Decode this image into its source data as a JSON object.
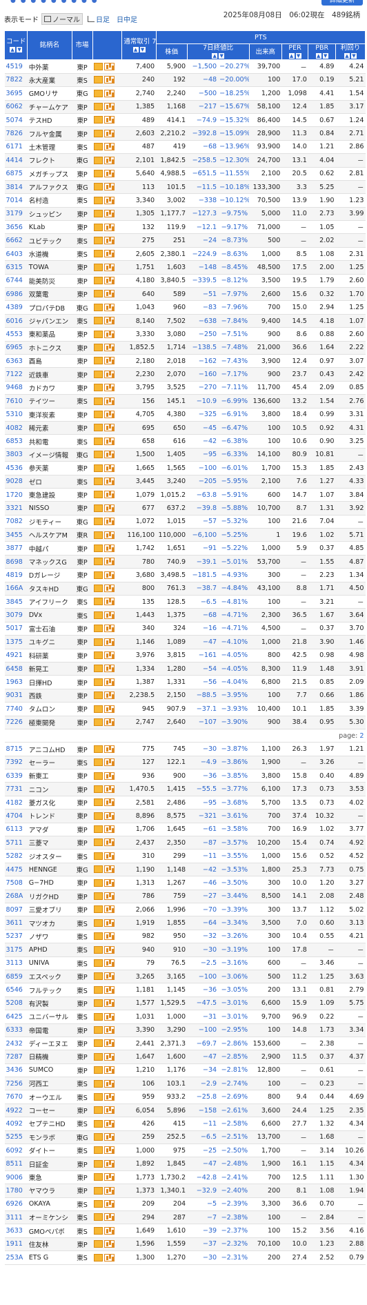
{
  "top": {
    "refresh_label": "詳細更新"
  },
  "header": {
    "display_mode_label": "表示モード",
    "modes": [
      "ノーマル",
      "日足",
      "日中足"
    ],
    "datetime": "2025年08月08日　06:02現在　489銘柄"
  },
  "columns": {
    "code": "コード",
    "name": "銘柄名",
    "market": "市場",
    "normal": "通常取引 7日終値",
    "pts": "PTS",
    "price": "株価",
    "change": "7日終値比",
    "volume": "出来高",
    "per": "PER",
    "pbr": "PBR",
    "yield": "利回り"
  },
  "page": {
    "label": "page:",
    "value": "2"
  },
  "rows": [
    [
      "4519",
      "中外薬",
      "東P",
      "7,400",
      "5,900",
      "−1,500",
      "−20.27%",
      "39,700",
      "－",
      "4.89",
      "4.24"
    ],
    [
      "7822",
      "永大産業",
      "東S",
      "240",
      "192",
      "−48",
      "−20.00%",
      "100",
      "17.0",
      "0.19",
      "5.21"
    ],
    [
      "3695",
      "GMOリサ",
      "東G",
      "2,740",
      "2,240",
      "−500",
      "−18.25%",
      "1,200",
      "1,098",
      "4.41",
      "1.54"
    ],
    [
      "6062",
      "チャームケア",
      "東P",
      "1,385",
      "1,168",
      "−217",
      "−15.67%",
      "58,100",
      "12.4",
      "1.85",
      "3.17"
    ],
    [
      "5074",
      "テスHD",
      "東P",
      "489",
      "414.1",
      "−74.9",
      "−15.32%",
      "86,400",
      "14.5",
      "0.67",
      "1.24"
    ],
    [
      "7826",
      "フルヤ金属",
      "東P",
      "2,603",
      "2,210.2",
      "−392.8",
      "−15.09%",
      "28,900",
      "11.3",
      "0.84",
      "2.71"
    ],
    [
      "6171",
      "土木管理",
      "東S",
      "487",
      "419",
      "−68",
      "−13.96%",
      "93,900",
      "14.0",
      "1.21",
      "2.86"
    ],
    [
      "4414",
      "フレクト",
      "東G",
      "2,101",
      "1,842.5",
      "−258.5",
      "−12.30%",
      "24,700",
      "13.1",
      "4.04",
      "－"
    ],
    [
      "6875",
      "メガチップス",
      "東P",
      "5,640",
      "4,988.5",
      "−651.5",
      "−11.55%",
      "2,100",
      "20.5",
      "0.62",
      "2.81"
    ],
    [
      "3814",
      "アルファクス",
      "東G",
      "113",
      "101.5",
      "−11.5",
      "−10.18%",
      "133,300",
      "3.3",
      "5.25",
      "－"
    ],
    [
      "7014",
      "名村造",
      "東S",
      "3,340",
      "3,002",
      "−338",
      "−10.12%",
      "70,500",
      "13.9",
      "1.90",
      "1.23"
    ],
    [
      "3179",
      "シュッピン",
      "東P",
      "1,305",
      "1,177.7",
      "−127.3",
      "−9.75%",
      "5,000",
      "11.0",
      "2.73",
      "3.99"
    ],
    [
      "3656",
      "KLab",
      "東P",
      "132",
      "119.9",
      "−12.1",
      "−9.17%",
      "71,000",
      "－",
      "1.05",
      "－"
    ],
    [
      "6662",
      "ユビテック",
      "東S",
      "275",
      "251",
      "−24",
      "−8.73%",
      "500",
      "－",
      "2.02",
      "－"
    ],
    [
      "6403",
      "水道機",
      "東S",
      "2,605",
      "2,380.1",
      "−224.9",
      "−8.63%",
      "1,000",
      "8.5",
      "1.08",
      "2.31"
    ],
    [
      "6315",
      "TOWA",
      "東P",
      "1,751",
      "1,603",
      "−148",
      "−8.45%",
      "48,500",
      "17.5",
      "2.00",
      "1.25"
    ],
    [
      "6744",
      "能美防災",
      "東P",
      "4,180",
      "3,840.5",
      "−339.5",
      "−8.12%",
      "3,500",
      "19.5",
      "1.79",
      "2.60"
    ],
    [
      "6986",
      "双葉電",
      "東P",
      "640",
      "589",
      "−51",
      "−7.97%",
      "2,600",
      "15.6",
      "0.32",
      "1.70"
    ],
    [
      "4389",
      "プロパテDB",
      "東G",
      "1,043",
      "960",
      "−83",
      "−7.96%",
      "700",
      "15.0",
      "2.94",
      "1.25"
    ],
    [
      "6016",
      "ジャパンエン",
      "東S",
      "8,140",
      "7,502",
      "−638",
      "−7.84%",
      "9,400",
      "14.5",
      "4.18",
      "1.07"
    ],
    [
      "4553",
      "東和薬品",
      "東P",
      "3,330",
      "3,080",
      "−250",
      "−7.51%",
      "900",
      "8.6",
      "0.88",
      "2.60"
    ],
    [
      "6965",
      "ホトニクス",
      "東P",
      "1,852.5",
      "1,714",
      "−138.5",
      "−7.48%",
      "21,000",
      "36.6",
      "1.64",
      "2.22"
    ],
    [
      "6363",
      "酉島",
      "東P",
      "2,180",
      "2,018",
      "−162",
      "−7.43%",
      "3,900",
      "12.4",
      "0.97",
      "3.07"
    ],
    [
      "7122",
      "近鉄車",
      "東P",
      "2,230",
      "2,070",
      "−160",
      "−7.17%",
      "900",
      "23.7",
      "0.43",
      "2.42"
    ],
    [
      "9468",
      "カドカワ",
      "東P",
      "3,795",
      "3,525",
      "−270",
      "−7.11%",
      "11,700",
      "45.4",
      "2.09",
      "0.85"
    ],
    [
      "7610",
      "テイツー",
      "東S",
      "156",
      "145.1",
      "−10.9",
      "−6.99%",
      "136,600",
      "13.2",
      "1.54",
      "2.76"
    ],
    [
      "5310",
      "東洋炭素",
      "東P",
      "4,705",
      "4,380",
      "−325",
      "−6.91%",
      "3,800",
      "18.4",
      "0.99",
      "3.31"
    ],
    [
      "4082",
      "稀元素",
      "東P",
      "695",
      "650",
      "−45",
      "−6.47%",
      "100",
      "10.5",
      "0.92",
      "4.31"
    ],
    [
      "6853",
      "共和電",
      "東S",
      "658",
      "616",
      "−42",
      "−6.38%",
      "100",
      "10.6",
      "0.90",
      "3.25"
    ],
    [
      "3803",
      "イメージ情報",
      "東G",
      "1,500",
      "1,405",
      "−95",
      "−6.33%",
      "14,100",
      "80.9",
      "10.81",
      "－"
    ],
    [
      "4536",
      "参天薬",
      "東P",
      "1,665",
      "1,565",
      "−100",
      "−6.01%",
      "1,700",
      "15.3",
      "1.85",
      "2.43"
    ],
    [
      "9028",
      "ゼロ",
      "東S",
      "3,445",
      "3,240",
      "−205",
      "−5.95%",
      "2,100",
      "7.6",
      "1.27",
      "4.33"
    ],
    [
      "1720",
      "東急建設",
      "東P",
      "1,079",
      "1,015.2",
      "−63.8",
      "−5.91%",
      "600",
      "14.7",
      "1.07",
      "3.84"
    ],
    [
      "3321",
      "NISSO",
      "東P",
      "677",
      "637.2",
      "−39.8",
      "−5.88%",
      "10,700",
      "8.7",
      "1.31",
      "3.92"
    ],
    [
      "7082",
      "ジモティー",
      "東G",
      "1,072",
      "1,015",
      "−57",
      "−5.32%",
      "100",
      "21.6",
      "7.04",
      "－"
    ],
    [
      "3455",
      "ヘルスケアM",
      "東R",
      "116,100",
      "110,000",
      "−6,100",
      "−5.25%",
      "1",
      "19.6",
      "1.02",
      "5.71"
    ],
    [
      "3877",
      "中越パ",
      "東P",
      "1,742",
      "1,651",
      "−91",
      "−5.22%",
      "1,000",
      "5.9",
      "0.37",
      "4.85"
    ],
    [
      "8698",
      "マネックスG",
      "東P",
      "780",
      "740.9",
      "−39.1",
      "−5.01%",
      "53,700",
      "－",
      "1.55",
      "4.87"
    ],
    [
      "4819",
      "Dガレージ",
      "東P",
      "3,680",
      "3,498.5",
      "−181.5",
      "−4.93%",
      "300",
      "－",
      "2.23",
      "1.34"
    ],
    [
      "166A",
      "タスキHD",
      "東G",
      "800",
      "761.3",
      "−38.7",
      "−4.84%",
      "43,100",
      "8.8",
      "1.71",
      "4.50"
    ],
    [
      "3845",
      "アイフリーク",
      "東S",
      "135",
      "128.5",
      "−6.5",
      "−4.81%",
      "100",
      "－",
      "3.21",
      "－"
    ],
    [
      "3079",
      "DVx",
      "東S",
      "1,443",
      "1,375",
      "−68",
      "−4.71%",
      "2,300",
      "36.5",
      "1.67",
      "3.64"
    ],
    [
      "5017",
      "富士石油",
      "東P",
      "340",
      "324",
      "−16",
      "−4.71%",
      "4,500",
      "－",
      "0.37",
      "3.70"
    ],
    [
      "1375",
      "ユキグニ",
      "東P",
      "1,146",
      "1,089",
      "−47",
      "−4.10%",
      "1,000",
      "21.8",
      "3.90",
      "1.46"
    ],
    [
      "4921",
      "科研薬",
      "東P",
      "3,976",
      "3,815",
      "−161",
      "−4.05%",
      "800",
      "42.5",
      "0.98",
      "4.98"
    ],
    [
      "6458",
      "新晃工",
      "東P",
      "1,334",
      "1,280",
      "−54",
      "−4.05%",
      "8,300",
      "11.9",
      "1.48",
      "3.91"
    ],
    [
      "1963",
      "日揮HD",
      "東P",
      "1,387",
      "1,331",
      "−56",
      "−4.04%",
      "6,800",
      "21.5",
      "0.85",
      "2.09"
    ],
    [
      "9031",
      "西鉄",
      "東P",
      "2,238.5",
      "2,150",
      "−88.5",
      "−3.95%",
      "100",
      "7.7",
      "0.66",
      "1.86"
    ],
    [
      "7740",
      "タムロン",
      "東P",
      "945",
      "907.9",
      "−37.1",
      "−3.93%",
      "10,400",
      "10.1",
      "1.85",
      "3.39"
    ],
    [
      "7226",
      "極東開発",
      "東P",
      "2,747",
      "2,640",
      "−107",
      "−3.90%",
      "900",
      "38.4",
      "0.95",
      "5.30"
    ],
    [
      "8715",
      "アニコムHD",
      "東P",
      "775",
      "745",
      "−30",
      "−3.87%",
      "1,100",
      "26.3",
      "1.97",
      "1.21"
    ],
    [
      "7392",
      "セーラー",
      "東S",
      "127",
      "122.1",
      "−4.9",
      "−3.86%",
      "1,900",
      "－",
      "3.26",
      "－"
    ],
    [
      "6339",
      "新東工",
      "東P",
      "936",
      "900",
      "−36",
      "−3.85%",
      "3,800",
      "15.8",
      "0.40",
      "4.89"
    ],
    [
      "7731",
      "ニコン",
      "東P",
      "1,470.5",
      "1,415",
      "−55.5",
      "−3.77%",
      "6,100",
      "17.3",
      "0.73",
      "3.53"
    ],
    [
      "4182",
      "菱ガス化",
      "東P",
      "2,581",
      "2,486",
      "−95",
      "−3.68%",
      "5,700",
      "13.5",
      "0.73",
      "4.02"
    ],
    [
      "4704",
      "トレンド",
      "東P",
      "8,896",
      "8,575",
      "−321",
      "−3.61%",
      "700",
      "37.4",
      "10.32",
      "－"
    ],
    [
      "6113",
      "アマダ",
      "東P",
      "1,706",
      "1,645",
      "−61",
      "−3.58%",
      "700",
      "16.9",
      "1.02",
      "3.77"
    ],
    [
      "5711",
      "三菱マ",
      "東P",
      "2,437",
      "2,350",
      "−87",
      "−3.57%",
      "10,200",
      "15.4",
      "0.74",
      "4.92"
    ],
    [
      "5282",
      "ジオスター",
      "東S",
      "310",
      "299",
      "−11",
      "−3.55%",
      "1,000",
      "15.6",
      "0.52",
      "4.52"
    ],
    [
      "4475",
      "HENNGE",
      "東G",
      "1,190",
      "1,148",
      "−42",
      "−3.53%",
      "1,800",
      "25.3",
      "7.73",
      "0.75"
    ],
    [
      "7508",
      "G−7HD",
      "東P",
      "1,313",
      "1,267",
      "−46",
      "−3.50%",
      "300",
      "10.0",
      "1.20",
      "3.27"
    ],
    [
      "268A",
      "リガクHD",
      "東P",
      "786",
      "759",
      "−27",
      "−3.44%",
      "8,500",
      "14.1",
      "2.08",
      "2.48"
    ],
    [
      "8097",
      "三愛オブリ",
      "東P",
      "2,066",
      "1,996",
      "−70",
      "−3.39%",
      "300",
      "13.7",
      "1.12",
      "5.02"
    ],
    [
      "3611",
      "マツオカ",
      "東S",
      "1,919",
      "1,855",
      "−64",
      "−3.34%",
      "3,500",
      "7.0",
      "0.60",
      "3.13"
    ],
    [
      "5237",
      "ノザワ",
      "東S",
      "982",
      "950",
      "−32",
      "−3.26%",
      "300",
      "10.4",
      "0.55",
      "4.21"
    ],
    [
      "3175",
      "APHD",
      "東S",
      "940",
      "910",
      "−30",
      "−3.19%",
      "100",
      "17.8",
      "－",
      "－"
    ],
    [
      "3113",
      "UNIVA",
      "東S",
      "79",
      "76.5",
      "−2.5",
      "−3.16%",
      "600",
      "－",
      "3.46",
      "－"
    ],
    [
      "6859",
      "エスペック",
      "東P",
      "3,265",
      "3,165",
      "−100",
      "−3.06%",
      "500",
      "11.2",
      "1.25",
      "3.63"
    ],
    [
      "6546",
      "フルテック",
      "東S",
      "1,181",
      "1,145",
      "−36",
      "−3.05%",
      "200",
      "13.1",
      "0.81",
      "2.79"
    ],
    [
      "5208",
      "有沢製",
      "東P",
      "1,577",
      "1,529.5",
      "−47.5",
      "−3.01%",
      "6,600",
      "15.9",
      "1.09",
      "5.75"
    ],
    [
      "6425",
      "ユニバーサル",
      "東S",
      "1,031",
      "1,000",
      "−31",
      "−3.01%",
      "9,700",
      "96.9",
      "0.22",
      "－"
    ],
    [
      "6333",
      "帝国電",
      "東P",
      "3,390",
      "3,290",
      "−100",
      "−2.95%",
      "100",
      "14.8",
      "1.73",
      "3.34"
    ],
    [
      "2432",
      "ディーエヌエ",
      "東P",
      "2,441",
      "2,371.3",
      "−69.7",
      "−2.86%",
      "153,600",
      "－",
      "2.38",
      "－"
    ],
    [
      "7287",
      "日精機",
      "東P",
      "1,647",
      "1,600",
      "−47",
      "−2.85%",
      "2,900",
      "11.5",
      "0.37",
      "4.37"
    ],
    [
      "3436",
      "SUMCO",
      "東P",
      "1,210",
      "1,176",
      "−34",
      "−2.81%",
      "12,800",
      "－",
      "0.61",
      "－"
    ],
    [
      "7256",
      "河西工",
      "東S",
      "106",
      "103.1",
      "−2.9",
      "−2.74%",
      "100",
      "－",
      "0.23",
      "－"
    ],
    [
      "7670",
      "オーウエル",
      "東S",
      "959",
      "933.2",
      "−25.8",
      "−2.69%",
      "800",
      "9.4",
      "0.44",
      "4.69"
    ],
    [
      "4922",
      "コーセー",
      "東P",
      "6,054",
      "5,896",
      "−158",
      "−2.61%",
      "3,600",
      "24.4",
      "1.25",
      "2.35"
    ],
    [
      "4092",
      "セプテニHD",
      "東S",
      "426",
      "415",
      "−11",
      "−2.58%",
      "6,600",
      "27.7",
      "1.32",
      "4.34"
    ],
    [
      "5255",
      "モンラボ",
      "東G",
      "259",
      "252.5",
      "−6.5",
      "−2.51%",
      "13,700",
      "－",
      "1.68",
      "－"
    ],
    [
      "6092",
      "ダイトー",
      "東S",
      "1,000",
      "975",
      "−25",
      "−2.50%",
      "1,700",
      "－",
      "3.14",
      "10.26"
    ],
    [
      "8511",
      "日証金",
      "東P",
      "1,892",
      "1,845",
      "−47",
      "−2.48%",
      "1,900",
      "16.1",
      "1.15",
      "4.34"
    ],
    [
      "9006",
      "東急",
      "東P",
      "1,773",
      "1,730.2",
      "−42.8",
      "−2.41%",
      "700",
      "12.5",
      "1.11",
      "1.30"
    ],
    [
      "1780",
      "ヤマウラ",
      "東P",
      "1,373",
      "1,340.1",
      "−32.9",
      "−2.40%",
      "200",
      "8.1",
      "1.08",
      "1.94"
    ],
    [
      "6926",
      "OKAYA",
      "東S",
      "209",
      "204",
      "−5",
      "−2.39%",
      "3,300",
      "36.6",
      "0.70",
      "－"
    ],
    [
      "3111",
      "オーミケンシ",
      "東S",
      "294",
      "287",
      "−7",
      "−2.38%",
      "100",
      "－",
      "2.84",
      "－"
    ],
    [
      "3633",
      "GMOペパボ",
      "東S",
      "1,649",
      "1,610",
      "−39",
      "−2.37%",
      "100",
      "15.2",
      "3.56",
      "4.16"
    ],
    [
      "1911",
      "住友林",
      "東P",
      "1,596",
      "1,559",
      "−37",
      "−2.32%",
      "70,100",
      "10.0",
      "1.23",
      "2.88"
    ],
    [
      "253A",
      "ETS G",
      "東S",
      "1,300",
      "1,270",
      "−30",
      "−2.31%",
      "200",
      "27.4",
      "2.52",
      "0.79"
    ]
  ]
}
